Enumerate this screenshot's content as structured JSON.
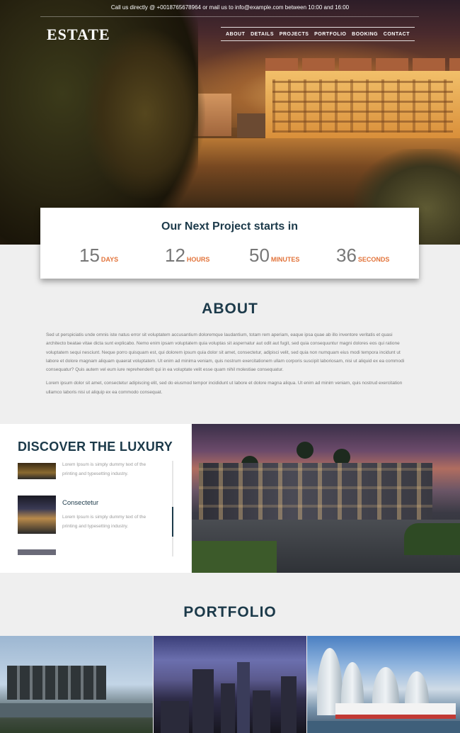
{
  "topbar": {
    "contact_text": "Call us directly @ +0018765678964 or mail us to info@example.com between 10:00 and 16:00"
  },
  "brand": {
    "logo": "ESTATE"
  },
  "nav": {
    "items": [
      "ABOUT",
      "DETAILS",
      "PROJECTS",
      "PORTFOLIO",
      "BOOKING",
      "CONTACT"
    ]
  },
  "countdown": {
    "title": "Our Next Project starts in",
    "units": [
      {
        "value": "15",
        "label": "DAYS"
      },
      {
        "value": "12",
        "label": "HOURS"
      },
      {
        "value": "50",
        "label": "MINUTES"
      },
      {
        "value": "36",
        "label": "SECONDS"
      }
    ]
  },
  "about": {
    "title": "ABOUT",
    "paragraph1": "Sed ut perspiciatis unde omnis iste natus error sit voluptatem accusantium doloremque laudantium, totam rem aperiam, eaque ipsa quae ab illo inventore veritatis et quasi architecto beatae vitae dicta sunt explicabo. Nemo enim ipsam voluptatem quia voluptas sit aspernatur aut odit aut fugit, sed quia consequuntur magni dolores eos qui ratione voluptatem sequi nesciunt. Neque porro quisquam est, qui dolorem ipsum quia dolor sit amet, consectetur, adipisci velit, sed quia non numquam eius modi tempora incidunt ut labore et dolore magnam aliquam quaerat voluptatem. Ut enim ad minima veniam, quis nostrum exercitationem ullam corporis suscipit laboriosam, nisi ut aliquid ex ea commodi consequatur? Quis autem vel eum iure reprehenderit qui in ea voluptate velit esse quam nihil molestiae consequatur.",
    "paragraph2": "Lorem ipsum dolor sit amet, consectetur adipiscing elit, sed do eiusmod tempor incididunt ut labore et dolore magna aliqua. Ut enim ad minim veniam, quis nostrud exercitation ullamco laboris nisi ut aliquip ex ea commodo consequat."
  },
  "luxury": {
    "title": "DISCOVER THE LUXURY",
    "items": [
      {
        "heading": "",
        "desc_line1": "Lorem Ipsum is simply dummy text of the",
        "desc_line2": "printing and typesetting industry."
      },
      {
        "heading": "Consectetur",
        "desc_line1": "Lorem Ipsum is simply dummy text of the",
        "desc_line2": "printing and typesetting industry."
      }
    ],
    "scroll_position": 0.5
  },
  "portfolio": {
    "title": "PORTFOLIO"
  },
  "colors": {
    "navy": "#1c3a4a",
    "accent_orange": "#e2733a"
  }
}
